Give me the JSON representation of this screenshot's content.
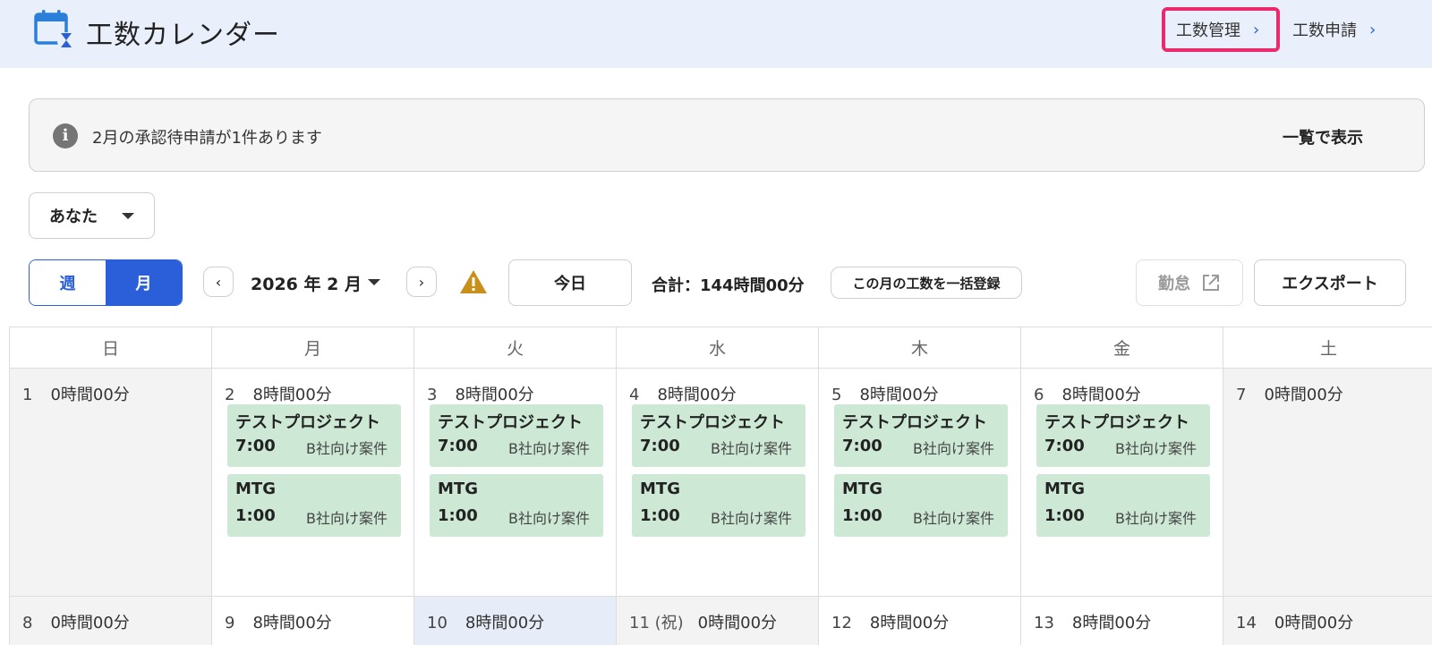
{
  "header": {
    "title": "工数カレンダー",
    "nav": [
      {
        "label": "工数管理"
      },
      {
        "label": "工数申請"
      }
    ]
  },
  "info": {
    "message": "2月の承認待申請が1件あります",
    "link": "一覧で表示"
  },
  "user_select": {
    "value": "あなた"
  },
  "view_toggle": {
    "week": "週",
    "month": "月"
  },
  "month_nav": {
    "label": "2026 年 2 月"
  },
  "toolbar": {
    "today": "今日",
    "total": "合計：144時間00分",
    "bulk_register": "この月の工数を一括登録",
    "kintai": "勤怠",
    "export": "エクスポート"
  },
  "calendar": {
    "weekdays": [
      "日",
      "月",
      "火",
      "水",
      "木",
      "金",
      "土"
    ],
    "weeks": [
      [
        {
          "day": "1",
          "hours": "0時間00分",
          "entries": []
        },
        {
          "day": "2",
          "hours": "8時間00分",
          "entries": [
            {
              "name": "テストプロジェクト",
              "time": "7:00",
              "case": "B社向け案件"
            },
            {
              "name": "MTG",
              "time": "1:00",
              "case": "B社向け案件"
            }
          ]
        },
        {
          "day": "3",
          "hours": "8時間00分",
          "entries": [
            {
              "name": "テストプロジェクト",
              "time": "7:00",
              "case": "B社向け案件"
            },
            {
              "name": "MTG",
              "time": "1:00",
              "case": "B社向け案件"
            }
          ]
        },
        {
          "day": "4",
          "hours": "8時間00分",
          "entries": [
            {
              "name": "テストプロジェクト",
              "time": "7:00",
              "case": "B社向け案件"
            },
            {
              "name": "MTG",
              "time": "1:00",
              "case": "B社向け案件"
            }
          ]
        },
        {
          "day": "5",
          "hours": "8時間00分",
          "entries": [
            {
              "name": "テストプロジェクト",
              "time": "7:00",
              "case": "B社向け案件"
            },
            {
              "name": "MTG",
              "time": "1:00",
              "case": "B社向け案件"
            }
          ]
        },
        {
          "day": "6",
          "hours": "8時間00分",
          "entries": [
            {
              "name": "テストプロジェクト",
              "time": "7:00",
              "case": "B社向け案件"
            },
            {
              "name": "MTG",
              "time": "1:00",
              "case": "B社向け案件"
            }
          ]
        },
        {
          "day": "7",
          "hours": "0時間00分",
          "entries": []
        }
      ],
      [
        {
          "day": "8",
          "hours": "0時間00分",
          "entries": []
        },
        {
          "day": "9",
          "hours": "8時間00分",
          "entries": []
        },
        {
          "day": "10",
          "hours": "8時間00分",
          "entries": [],
          "today": true
        },
        {
          "day": "11 (祝)",
          "hours": "0時間00分",
          "entries": [],
          "holiday": true
        },
        {
          "day": "12",
          "hours": "8時間00分",
          "entries": []
        },
        {
          "day": "13",
          "hours": "8時間00分",
          "entries": []
        },
        {
          "day": "14",
          "hours": "0時間00分",
          "entries": []
        }
      ]
    ]
  },
  "colors": {
    "header_bg": "#eaf0fb",
    "accent": "#2b5fd9",
    "highlight_border": "#ea2a6a",
    "entry_bg": "#cde9d5",
    "warning": "#c8901a",
    "weekend_bg": "#f4f3f3",
    "today_bg": "#e6edf8"
  },
  "icons": {
    "app": "calendar-hourglass-icon",
    "info": "info-icon",
    "warning": "warning-icon",
    "external": "external-link-icon"
  }
}
